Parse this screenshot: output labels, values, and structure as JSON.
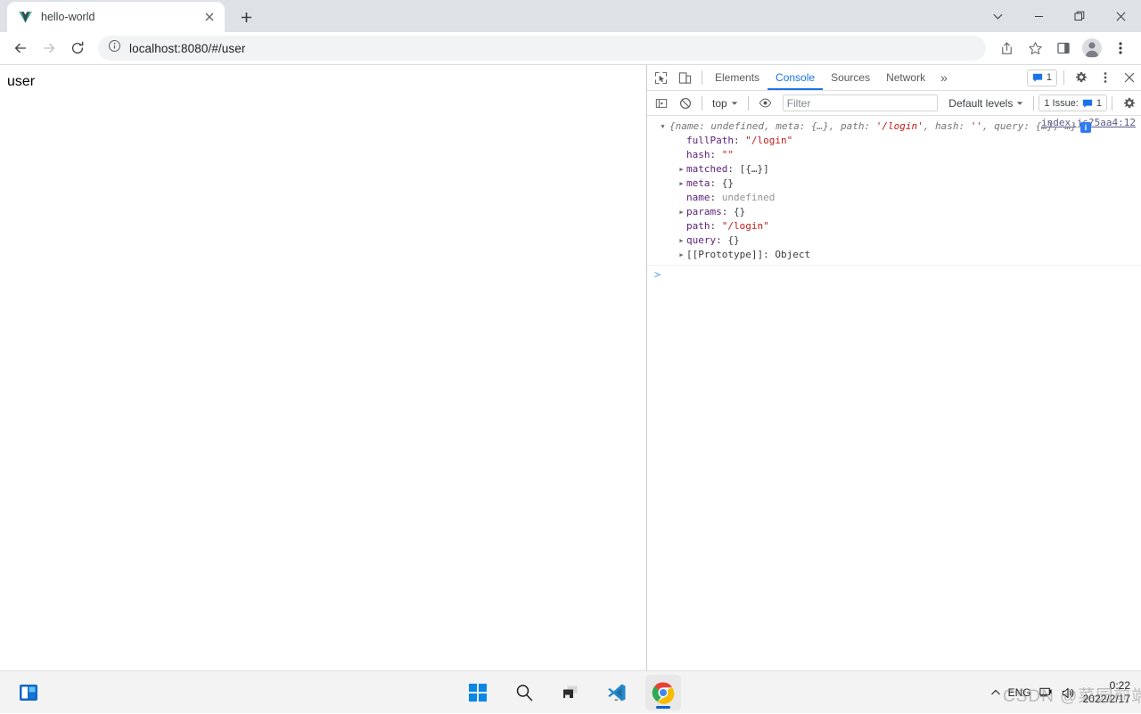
{
  "browser": {
    "tab": {
      "title": "hello-world",
      "favicon": "vue-logo-icon",
      "close_icon": "close-icon"
    },
    "new_tab_label": "+",
    "window_controls": {
      "tab_search": "chevron-down-icon",
      "minimize": "minimize-icon",
      "maximize": "maximize-icon",
      "close": "close-icon"
    },
    "toolbar": {
      "back": "back-arrow-icon",
      "forward": "forward-arrow-icon",
      "reload": "reload-icon",
      "site_info": "info-circle-icon",
      "url_host": "localhost:8080",
      "url_path": "/#/user",
      "url_full": "localhost:8080/#/user",
      "share": "share-icon",
      "bookmark": "star-icon",
      "side_panel": "side-panel-icon",
      "profile": "avatar-icon",
      "menu": "kebab-menu-icon"
    }
  },
  "page": {
    "body_text": "user"
  },
  "devtools": {
    "topbar": {
      "inspect_icon": "inspect-element-icon",
      "device_icon": "device-toolbar-icon",
      "tabs": [
        {
          "label": "Elements",
          "active": false
        },
        {
          "label": "Console",
          "active": true
        },
        {
          "label": "Sources",
          "active": false
        },
        {
          "label": "Network",
          "active": false
        }
      ],
      "more_tabs": "»",
      "message_count": "1",
      "message_icon": "message-box-icon",
      "settings_icon": "gear-icon",
      "menu_icon": "kebab-menu-icon",
      "close_icon": "close-icon"
    },
    "filterbar": {
      "sidebar_icon": "console-sidebar-icon",
      "clear_icon": "clear-console-icon",
      "context": "top",
      "context_caret": "chevron-down-icon",
      "eye_icon": "eye-icon",
      "filter_placeholder": "Filter",
      "filter_value": "",
      "levels": "Default levels",
      "levels_caret": "chevron-down-icon",
      "issues_label": "1 Issue:",
      "issues_icon": "message-box-icon",
      "issues_count": "1",
      "settings_icon": "gear-icon"
    },
    "console": {
      "source_link": "index.js?5aa4:12",
      "preview": {
        "open_brace": "{",
        "segments": [
          {
            "text": "name: undefined, meta: {…}, path: ",
            "kind": "plain"
          },
          {
            "text": "'/login'",
            "kind": "string"
          },
          {
            "text": ", hash: ",
            "kind": "plain"
          },
          {
            "text": "''",
            "kind": "string"
          },
          {
            "text": ", query: {…}, …}",
            "kind": "plain"
          }
        ],
        "info_badge": "i"
      },
      "properties": [
        {
          "expandable": false,
          "name": "fullPath",
          "sep": ": ",
          "value": "\"/login\"",
          "kind": "string"
        },
        {
          "expandable": false,
          "name": "hash",
          "sep": ": ",
          "value": "\"\"",
          "kind": "string"
        },
        {
          "expandable": true,
          "name": "matched",
          "sep": ": ",
          "value": "[{…}]",
          "kind": "object"
        },
        {
          "expandable": true,
          "name": "meta",
          "sep": ": ",
          "value": "{}",
          "kind": "object"
        },
        {
          "expandable": false,
          "name": "name",
          "sep": ": ",
          "value": "undefined",
          "kind": "undefined"
        },
        {
          "expandable": true,
          "name": "params",
          "sep": ": ",
          "value": "{}",
          "kind": "object"
        },
        {
          "expandable": false,
          "name": "path",
          "sep": ": ",
          "value": "\"/login\"",
          "kind": "string"
        },
        {
          "expandable": true,
          "name": "query",
          "sep": ": ",
          "value": "{}",
          "kind": "object"
        },
        {
          "expandable": true,
          "name": "[[Prototype]]",
          "sep": ": ",
          "value": "Object",
          "kind": "object"
        }
      ],
      "prompt": ">"
    }
  },
  "taskbar": {
    "widgets_icon": "widgets-icon",
    "items": [
      {
        "name": "start-button",
        "icon": "windows-start-icon",
        "active": false
      },
      {
        "name": "search-button",
        "icon": "search-icon",
        "active": false
      },
      {
        "name": "task-view-button",
        "icon": "task-view-icon",
        "active": false
      },
      {
        "name": "vscode-button",
        "icon": "vscode-icon",
        "active": false
      },
      {
        "name": "chrome-button",
        "icon": "chrome-icon",
        "active": true
      }
    ],
    "tray": {
      "overflow_caret": "chevron-up-icon",
      "language": "ENG",
      "network_icon": "network-icon",
      "volume_icon": "volume-icon",
      "time": "0:22",
      "date": "2022/2/17"
    },
    "watermark": "CSDN @菜园前端"
  },
  "colors": {
    "accent": "#1a73e8",
    "tabstrip_bg": "#dee1e6",
    "omnibox_bg": "#f1f3f4",
    "string_red": "#c41a16",
    "prop_purple": "#881391",
    "taskbar_bg": "#f3f3f3"
  }
}
